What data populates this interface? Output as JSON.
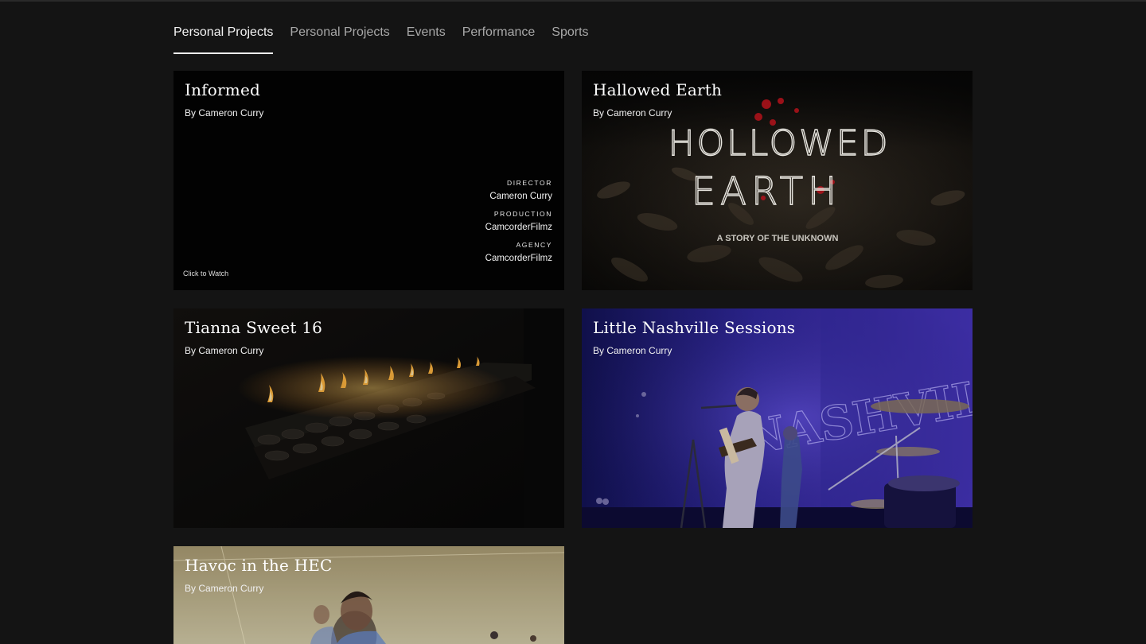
{
  "tabs": [
    {
      "label": "Personal Projects",
      "active": true
    },
    {
      "label": "Personal Projects",
      "active": false
    },
    {
      "label": "Events",
      "active": false
    },
    {
      "label": "Performance",
      "active": false
    },
    {
      "label": "Sports",
      "active": false
    }
  ],
  "cards": {
    "informed": {
      "title": "Informed",
      "byline": "By Cameron Curry",
      "credits": [
        {
          "role": "DIRECTOR",
          "name": "Cameron Curry"
        },
        {
          "role": "PRODUCTION",
          "name": "CamcorderFilmz"
        },
        {
          "role": "AGENCY",
          "name": "CamcorderFilmz"
        }
      ],
      "cta": "Click to Watch"
    },
    "hallowed": {
      "title": "Hallowed Earth",
      "byline": "By Cameron Curry",
      "poster_line1": "HOLLOWED",
      "poster_line2": "EARTH",
      "poster_tagline": "A STORY OF THE UNKNOWN"
    },
    "tianna": {
      "title": "Tianna Sweet 16",
      "byline": "By Cameron Curry"
    },
    "nashville": {
      "title": "Little Nashville Sessions",
      "byline": "By Cameron Curry",
      "banner_text": "NASHVILLE"
    },
    "havoc": {
      "title": "Havoc in the HEC",
      "byline": "By Cameron Curry"
    }
  },
  "colors": {
    "page_bg": "#141414",
    "tab_active": "#f2f2f2",
    "tab_inactive": "#a8a8a8",
    "stage_purple": "#3a2a9a",
    "blood_red": "#b3121b"
  }
}
